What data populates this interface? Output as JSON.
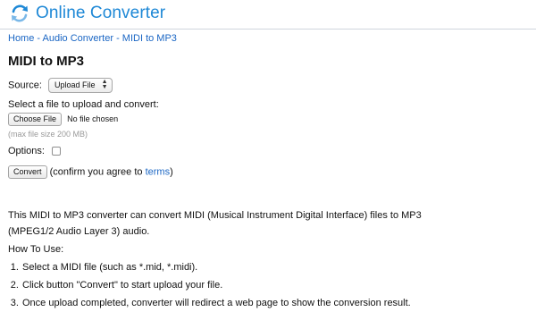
{
  "header": {
    "logo_text": "Online Converter",
    "logo_icon": "refresh-arrows-icon",
    "accent_color": "#1e88d6"
  },
  "breadcrumb": {
    "items": [
      "Home",
      "Audio Converter",
      "MIDI to MP3"
    ],
    "separator": " - "
  },
  "page_title": "MIDI to MP3",
  "form": {
    "source_label": "Source:",
    "source_value": "Upload File",
    "select_file_label": "Select a file to upload and convert:",
    "choose_file_button": "Choose File",
    "no_file_text": "No file chosen",
    "max_size_text": "(max file size 200 MB)",
    "options_label": "Options:",
    "convert_button": "Convert",
    "confirm_prefix": "(confirm you agree to ",
    "terms_link": "terms",
    "confirm_suffix": ")"
  },
  "description": "This MIDI to MP3 converter can convert MIDI (Musical Instrument Digital Interface) files to MP3 (MPEG1/2 Audio Layer 3) audio.",
  "how_to": {
    "title": "How To Use:",
    "steps": [
      "Select a MIDI file (such as *.mid, *.midi).",
      "Click button \"Convert\" to start upload your file.",
      "Once upload completed, converter will redirect a web page to show the conversion result."
    ]
  }
}
